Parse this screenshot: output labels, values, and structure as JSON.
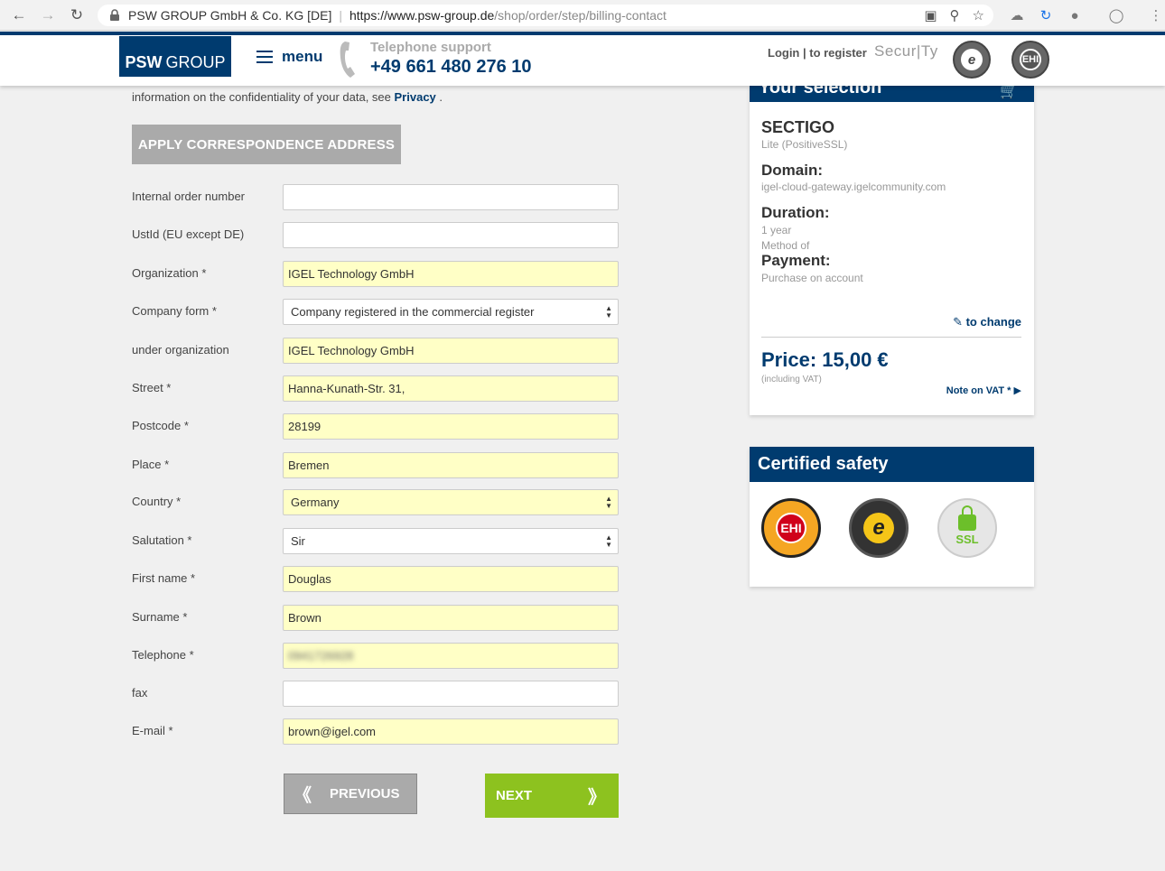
{
  "browser": {
    "page_origin": "PSW GROUP GmbH & Co. KG [DE]",
    "url_host": "https://www.psw-group.de",
    "url_path": "/shop/order/step/billing-contact"
  },
  "header": {
    "logo_bold": "PSW",
    "logo_text": "GROUP",
    "menu_label": "menu",
    "phone_label": "Telephone support",
    "phone_number": "+49 661 480 276 10",
    "login_label": "Login | to register",
    "security_logo": "Secur|Ty"
  },
  "form": {
    "privacy_text": "information on the confidentiality of your data, see ",
    "privacy_link": "Privacy",
    "privacy_suffix": " .",
    "apply_button": "APPLY CORRESPONDENCE ADDRESS",
    "fields": [
      {
        "label": "Internal order number",
        "value": "",
        "type": "input",
        "filled": false
      },
      {
        "label": "UstId (EU except DE)",
        "value": "",
        "type": "input",
        "filled": false
      },
      {
        "label": "Organization *",
        "value": "IGEL Technology GmbH",
        "type": "input",
        "filled": true
      },
      {
        "label": "Company form *",
        "value": "Company registered in the commercial register",
        "type": "select",
        "filled": false
      },
      {
        "label": "under organization",
        "value": "IGEL Technology GmbH",
        "type": "input",
        "filled": true
      },
      {
        "label": "Street *",
        "value": "Hanna-Kunath-Str. 31,",
        "type": "input",
        "filled": true
      },
      {
        "label": "Postcode *",
        "value": "28199",
        "type": "input",
        "filled": true
      },
      {
        "label": "Place *",
        "value": "Bremen",
        "type": "input",
        "filled": true
      },
      {
        "label": "Country *",
        "value": "Germany",
        "type": "select",
        "filled": true
      },
      {
        "label": "Salutation *",
        "value": "Sir",
        "type": "select",
        "filled": false
      },
      {
        "label": "First name *",
        "value": "Douglas",
        "type": "input",
        "filled": true
      },
      {
        "label": "Surname *",
        "value": "Brown",
        "type": "input",
        "filled": true
      },
      {
        "label": "Telephone *",
        "value": "0941726928",
        "type": "input",
        "filled": true,
        "blurred": true
      },
      {
        "label": "fax",
        "value": "",
        "type": "input",
        "filled": false
      },
      {
        "label": "E-mail *",
        "value": "brown@igel.com",
        "type": "input",
        "filled": true
      }
    ],
    "previous_button": "PREVIOUS",
    "next_button": "NEXT"
  },
  "selection": {
    "title": "Your selection",
    "product": "SECTIGO",
    "product_sub": "Lite (PositiveSSL)",
    "domain_label": "Domain:",
    "domain_value": "igel-cloud-gateway.igelcommunity.com",
    "duration_label": "Duration:",
    "duration_value": "1 year",
    "method_of": "Method of",
    "payment_label": "Payment:",
    "payment_value": "Purchase on account",
    "change_link": "to change",
    "price": "Price: 15,00 €",
    "including_vat": "(including VAT)",
    "vat_note": "Note on VAT *"
  },
  "safety": {
    "title": "Certified safety",
    "ehi_text": "EHI",
    "ssl_text": "SSL"
  },
  "colors": {
    "brand": "#003b6f",
    "next": "#8dc21f",
    "autofill": "#ffffc6"
  }
}
